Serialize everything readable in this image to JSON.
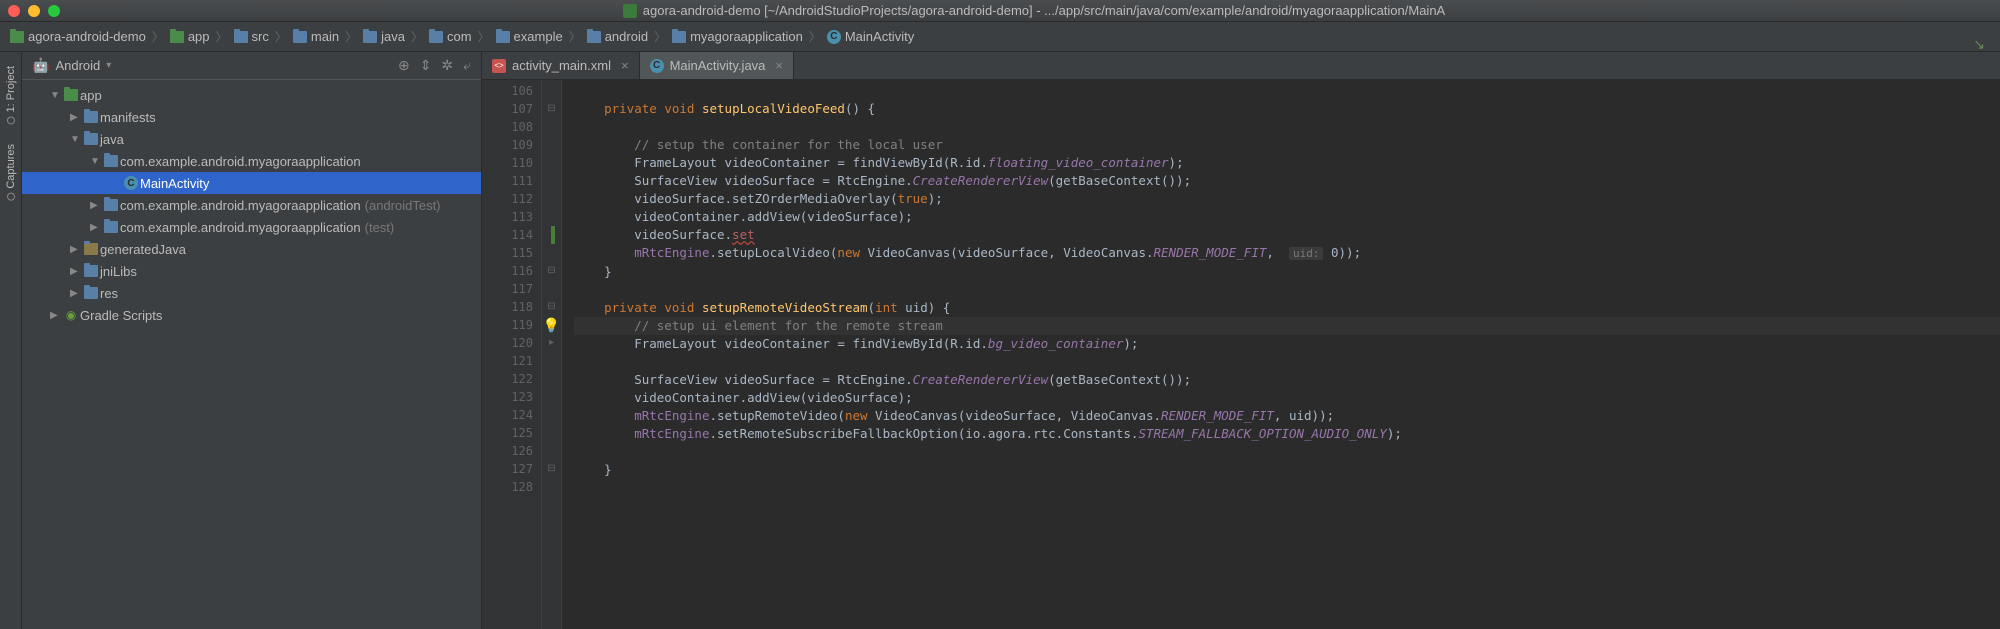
{
  "titlebar": {
    "title": "agora-android-demo [~/AndroidStudioProjects/agora-android-demo] - .../app/src/main/java/com/example/android/myagoraapplication/MainA"
  },
  "breadcrumb": [
    {
      "label": "agora-android-demo",
      "icon": "folder-green"
    },
    {
      "label": "app",
      "icon": "folder-green"
    },
    {
      "label": "src",
      "icon": "folder"
    },
    {
      "label": "main",
      "icon": "folder"
    },
    {
      "label": "java",
      "icon": "folder"
    },
    {
      "label": "com",
      "icon": "folder"
    },
    {
      "label": "example",
      "icon": "folder"
    },
    {
      "label": "android",
      "icon": "folder"
    },
    {
      "label": "myagoraapplication",
      "icon": "folder"
    },
    {
      "label": "MainActivity",
      "icon": "class"
    }
  ],
  "side_tabs": [
    {
      "label": "1: Project",
      "icon": "dot"
    },
    {
      "label": "Captures",
      "icon": "dot"
    }
  ],
  "project_panel": {
    "header": {
      "title": "Android",
      "mode_arrow": "▾"
    },
    "tools": [
      "target",
      "collapse",
      "gear",
      "hide"
    ],
    "tree": [
      {
        "depth": 1,
        "arrow": "down",
        "icon": "folder-green",
        "label": "app"
      },
      {
        "depth": 2,
        "arrow": "right",
        "icon": "folder",
        "label": "manifests"
      },
      {
        "depth": 2,
        "arrow": "down",
        "icon": "folder",
        "label": "java"
      },
      {
        "depth": 3,
        "arrow": "down",
        "icon": "folder",
        "label": "com.example.android.myagoraapplication"
      },
      {
        "depth": 4,
        "arrow": "",
        "icon": "class",
        "label": "MainActivity",
        "selected": true
      },
      {
        "depth": 3,
        "arrow": "right",
        "icon": "folder",
        "label": "com.example.android.myagoraapplication",
        "meta": "(androidTest)"
      },
      {
        "depth": 3,
        "arrow": "right",
        "icon": "folder",
        "label": "com.example.android.myagoraapplication",
        "meta": "(test)"
      },
      {
        "depth": 2,
        "arrow": "right",
        "icon": "folder-gen",
        "label": "generatedJava"
      },
      {
        "depth": 2,
        "arrow": "right",
        "icon": "folder",
        "label": "jniLibs"
      },
      {
        "depth": 2,
        "arrow": "right",
        "icon": "folder",
        "label": "res"
      },
      {
        "depth": 1,
        "arrow": "right",
        "icon": "gradle",
        "label": "Gradle Scripts"
      }
    ]
  },
  "editor_tabs": [
    {
      "label": "activity_main.xml",
      "icon": "xml",
      "active": false
    },
    {
      "label": "MainActivity.java",
      "icon": "class",
      "active": true
    }
  ],
  "editor": {
    "first_line": 106,
    "lines": [
      {
        "n": 106,
        "t": ""
      },
      {
        "n": 107,
        "t": "    private void setupLocalVideoFeed() {"
      },
      {
        "n": 108,
        "t": ""
      },
      {
        "n": 109,
        "t": "        // setup the container for the local user"
      },
      {
        "n": 110,
        "t": "        FrameLayout videoContainer = findViewById(R.id.floating_video_container);"
      },
      {
        "n": 111,
        "t": "        SurfaceView videoSurface = RtcEngine.CreateRendererView(getBaseContext());"
      },
      {
        "n": 112,
        "t": "        videoSurface.setZOrderMediaOverlay(true);"
      },
      {
        "n": 113,
        "t": "        videoContainer.addView(videoSurface);"
      },
      {
        "n": 114,
        "t": "        videoSurface.set"
      },
      {
        "n": 115,
        "t": "        mRtcEngine.setupLocalVideo(new VideoCanvas(videoSurface, VideoCanvas.RENDER_MODE_FIT,  uid: 0));"
      },
      {
        "n": 116,
        "t": "    }"
      },
      {
        "n": 117,
        "t": ""
      },
      {
        "n": 118,
        "t": "    private void setupRemoteVideoStream(int uid) {"
      },
      {
        "n": 119,
        "t": "        // setup ui element for the remote stream"
      },
      {
        "n": 120,
        "t": "        FrameLayout videoContainer = findViewById(R.id.bg_video_container);"
      },
      {
        "n": 121,
        "t": ""
      },
      {
        "n": 122,
        "t": "        SurfaceView videoSurface = RtcEngine.CreateRendererView(getBaseContext());"
      },
      {
        "n": 123,
        "t": "        videoContainer.addView(videoSurface);"
      },
      {
        "n": 124,
        "t": "        mRtcEngine.setupRemoteVideo(new VideoCanvas(videoSurface, VideoCanvas.RENDER_MODE_FIT, uid));"
      },
      {
        "n": 125,
        "t": "        mRtcEngine.setRemoteSubscribeFallbackOption(io.agora.rtc.Constants.STREAM_FALLBACK_OPTION_AUDIO_ONLY);"
      },
      {
        "n": 126,
        "t": ""
      },
      {
        "n": 127,
        "t": "    }"
      },
      {
        "n": 128,
        "t": ""
      }
    ]
  }
}
